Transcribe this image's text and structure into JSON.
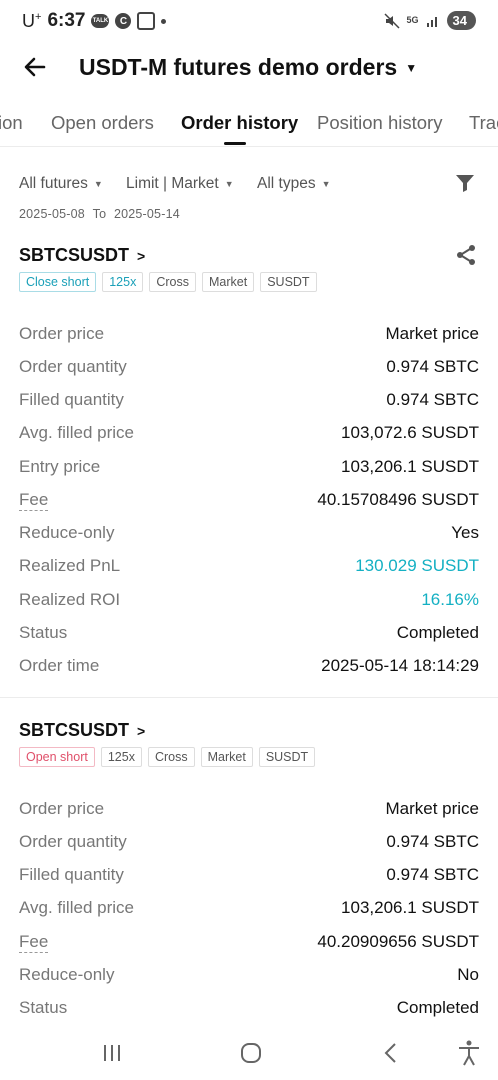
{
  "status_bar": {
    "carrier": "U",
    "carrier_sup": "+",
    "time": "6:37",
    "talk_label": "TALK",
    "c_label": "C",
    "network": "5G",
    "battery": "34",
    "icons": [
      "talk-icon",
      "c-app-icon",
      "screenshot-icon",
      "dot-icon",
      "mute-icon",
      "5g-icon",
      "signal-icon",
      "battery-icon"
    ]
  },
  "header": {
    "title": "USDT-M futures demo orders",
    "title_caret": "▼",
    "back_icon": "arrow-left-icon"
  },
  "tabs": [
    {
      "label": "ion"
    },
    {
      "label": "Open orders"
    },
    {
      "label": "Order history",
      "active": true
    },
    {
      "label": "Position history"
    },
    {
      "label": "Trac"
    }
  ],
  "filters": {
    "all_futures": "All futures",
    "order_kind": "Limit | Market",
    "all_types": "All types",
    "caret": "▼",
    "filter_icon": "funnel-icon",
    "date_from": "2025-05-08",
    "date_to_label": "To",
    "date_to": "2025-05-14"
  },
  "orders": [
    {
      "symbol": "SBTCSUSDT",
      "chevron": ">",
      "tags": [
        "Close short",
        "125x",
        "Cross",
        "Market",
        "SUSDT"
      ],
      "rows": [
        {
          "label": "Order price",
          "value": "Market price"
        },
        {
          "label": "Order quantity",
          "value": "0.974 SBTC"
        },
        {
          "label": "Filled quantity",
          "value": "0.974 SBTC"
        },
        {
          "label": "Avg. filled price",
          "value": "103,072.6 SUSDT"
        },
        {
          "label": "Entry price",
          "value": "103,206.1 SUSDT"
        },
        {
          "label": "Fee",
          "value": "40.15708496 SUSDT"
        },
        {
          "label": "Reduce-only",
          "value": "Yes"
        },
        {
          "label": "Realized PnL",
          "value": "130.029 SUSDT"
        },
        {
          "label": "Realized ROI",
          "value": "16.16%"
        },
        {
          "label": "Status",
          "value": "Completed"
        },
        {
          "label": "Order time",
          "value": "2025-05-14 18:14:29"
        }
      ]
    },
    {
      "symbol": "SBTCSUSDT",
      "chevron": ">",
      "tags": [
        "Open short",
        "125x",
        "Cross",
        "Market",
        "SUSDT"
      ],
      "rows": [
        {
          "label": "Order price",
          "value": "Market price"
        },
        {
          "label": "Order quantity",
          "value": "0.974 SBTC"
        },
        {
          "label": "Filled quantity",
          "value": "0.974 SBTC"
        },
        {
          "label": "Avg. filled price",
          "value": "103,206.1 SUSDT"
        },
        {
          "label": "Fee",
          "value": "40.20909656 SUSDT"
        },
        {
          "label": "Reduce-only",
          "value": "No"
        },
        {
          "label": "Status",
          "value": "Completed"
        }
      ]
    }
  ],
  "colors": {
    "profit": "#14b0c3",
    "close_short": "#1aa0b8",
    "open_short": "#e0506a"
  },
  "nav_bar": {
    "icons": [
      "recent-apps-icon",
      "home-icon",
      "back-icon",
      "accessibility-icon"
    ]
  }
}
